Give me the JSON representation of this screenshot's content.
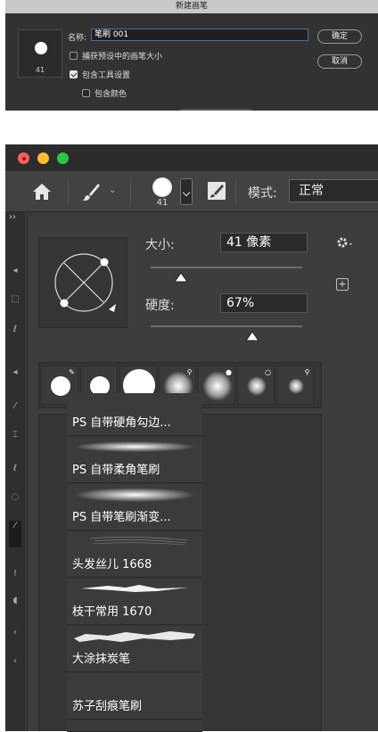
{
  "dialog": {
    "title": "新建画笔",
    "preview_size": "41",
    "name_label": "名称:",
    "name_value": "笔刷 001",
    "check_capture": "捕获预设中的画笔大小",
    "check_tool": "包含工具设置",
    "check_color": "包含颜色",
    "ok_label": "确定",
    "cancel_label": "取消"
  },
  "toolbar": {
    "brush_size": "41",
    "mode_label": "模式:",
    "mode_value": "正常"
  },
  "toolstrip": {
    "expand": "››"
  },
  "brush_panel": {
    "size_label": "大小:",
    "size_value": "41 像素",
    "size_fraction": 0.2,
    "hardness_label": "硬度:",
    "hardness_value": "67%",
    "hardness_fraction": 0.67,
    "recent_brushes": [
      "hard-round-edit",
      "hard-round",
      "hard-round-large",
      "soft-round-pressure",
      "soft-round-opacity",
      "soft-round-airbrush",
      "soft-round-pressure-small"
    ],
    "brush_list": [
      "PS 自带硬角勾边...",
      "PS 自带柔角笔刷",
      "PS 自带笔刷渐变...",
      "头发丝儿 1668",
      "枝干常用 1670",
      "大涂抹炭笔",
      "苏子刮痕笔刷"
    ]
  },
  "colors": {
    "red": "#ff5f57",
    "yellow": "#febc2e",
    "green": "#28c840",
    "panel": "#3d3d3d"
  }
}
